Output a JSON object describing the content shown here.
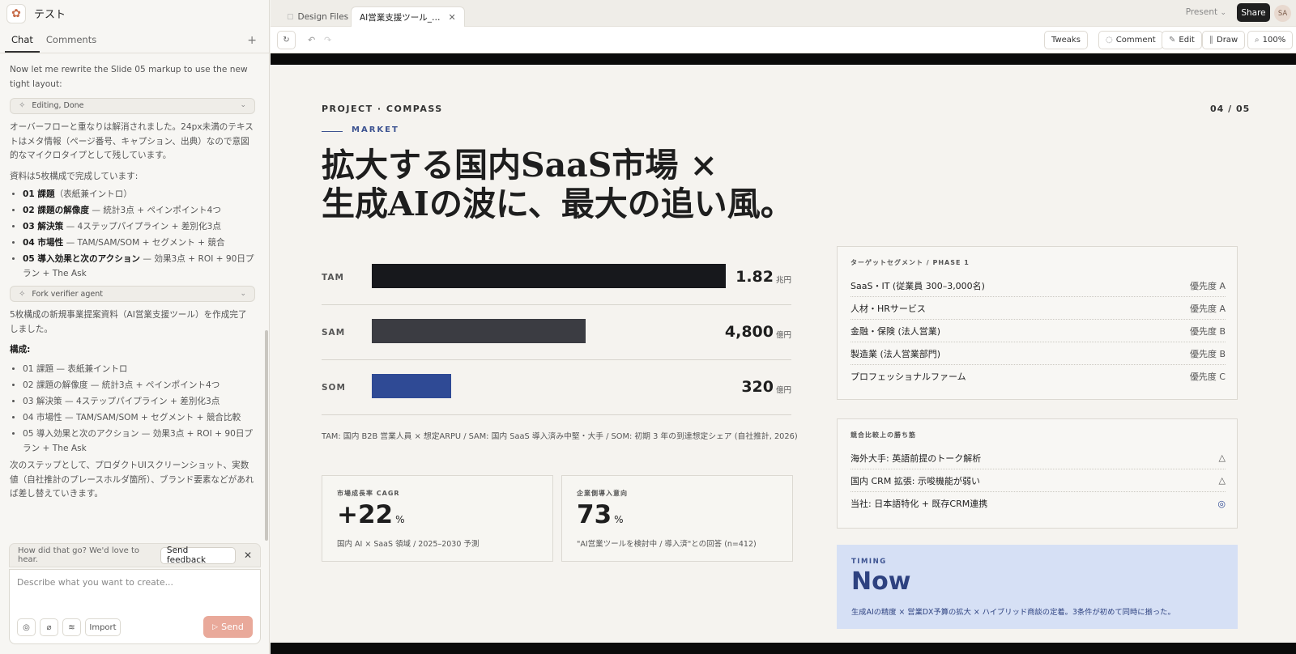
{
  "project": {
    "name": "テスト"
  },
  "left_tabs": {
    "chat": "Chat",
    "comments": "Comments",
    "add": "+"
  },
  "chat": {
    "msg1": "Now let me rewrite the Slide 05 markup to use the new tight layout:",
    "pill1": "Editing, Done",
    "msg2": "オーバーフローと重なりは解消されました。24px未満のテキストはメタ情報（ページ番号、キャプション、出典）なので意図的なマイクロタイプとして残しています。",
    "msg3": "資料は5枚構成で完成しています:",
    "list1": [
      {
        "b": "01 課題",
        "t": "（表紙兼イントロ）"
      },
      {
        "b": "02 課題の解像度",
        "t": " — 統計3点 + ペインポイント4つ"
      },
      {
        "b": "03 解決策",
        "t": " — 4ステップパイプライン + 差別化3点"
      },
      {
        "b": "04 市場性",
        "t": " — TAM/SAM/SOM + セグメント + 競合"
      },
      {
        "b": "05 導入効果と次のアクション",
        "t": " — 効果3点 + ROI + 90日プラン + The Ask"
      }
    ],
    "pill2": "Fork verifier agent",
    "msg4": "5枚構成の新規事業提案資料（AI営業支援ツール）を作成完了しました。",
    "msg5": "構成:",
    "list2": [
      "01 課題 — 表紙兼イントロ",
      "02 課題の解像度 — 統計3点 + ペインポイント4つ",
      "03 解決策 — 4ステップパイプライン + 差別化3点",
      "04 市場性 — TAM/SAM/SOM + セグメント + 競合比較",
      "05 導入効果と次のアクション — 効果3点 + ROI + 90日プラン + The Ask"
    ],
    "msg6": "次のステップとして、プロダクトUIスクリーンショット、実数値（自社推計のプレースホルダ箇所）、ブランド要素などがあれば差し替えていきます。"
  },
  "feedback": {
    "prompt": "How did that go? We'd love to hear.",
    "button": "Send feedback",
    "close": "✕"
  },
  "composer": {
    "placeholder": "Describe what you want to create...",
    "import": "Import",
    "send": "Send"
  },
  "tabs": {
    "design_files": "Design Files",
    "active": "AI営業支援ツール_…",
    "close": "✕"
  },
  "topbar": {
    "present": "Present",
    "share": "Share",
    "avatar": "SA"
  },
  "toolbar": {
    "tweaks": "Tweaks",
    "comment": "Comment",
    "edit": "Edit",
    "draw": "Draw",
    "zoom": "100%"
  },
  "slide": {
    "project_label": "PROJECT · COMPASS",
    "page": "04 / 05",
    "section": "MARKET",
    "title_line1": "拡大する国内SaaS市場 ×",
    "title_line2": "生成AIの波に、最大の追い風。",
    "market_bars": [
      {
        "label": "TAM",
        "value": "1.82",
        "unit": "兆円",
        "fraction": 0.795,
        "color": "#17181c"
      },
      {
        "label": "SAM",
        "value": "4,800",
        "unit": "億円",
        "fraction": 0.48,
        "color": "#3b3c42"
      },
      {
        "label": "SOM",
        "value": "320",
        "unit": "億円",
        "fraction": 0.178,
        "color": "#2f4a95"
      }
    ],
    "footnote": "TAM: 国内 B2B 営業人員 × 想定ARPU / SAM: 国内 SaaS 導入済み中堅・大手 / SOM: 初期 3 年の到達想定シェア (自社推計, 2026)",
    "kpi1": {
      "label": "市場成長率 CAGR",
      "value": "+22",
      "unit": "%",
      "note": "国内 AI × SaaS 領域 / 2025–2030 予測"
    },
    "kpi2": {
      "label": "企業側導入意向",
      "value": "73",
      "unit": "%",
      "note": "\"AI営業ツールを検討中 / 導入済\"との回答 (n=412)"
    },
    "segments": {
      "title": "ターゲットセグメント / PHASE 1",
      "rows": [
        {
          "name": "SaaS・IT (従業員 300–3,000名)",
          "priority": "優先度 A"
        },
        {
          "name": "人材・HRサービス",
          "priority": "優先度 A"
        },
        {
          "name": "金融・保険 (法人営業)",
          "priority": "優先度 B"
        },
        {
          "name": "製造業 (法人営業部門)",
          "priority": "優先度 B"
        },
        {
          "name": "プロフェッショナルファーム",
          "priority": "優先度 C"
        }
      ]
    },
    "competition": {
      "title": "競合比較上の勝ち筋",
      "rows": [
        {
          "name": "海外大手: 英語前提のトーク解析",
          "mark": "△"
        },
        {
          "name": "国内 CRM 拡張: 示唆機能が弱い",
          "mark": "△"
        },
        {
          "name": "当社: 日本語特化 + 既存CRM連携",
          "mark": "◎"
        }
      ]
    },
    "timing": {
      "label": "TIMING",
      "value": "Now",
      "note": "生成AIの精度 × 営業DX予算の拡大 × ハイブリッド商談の定着。3条件が初めて同時に揃った。"
    }
  }
}
